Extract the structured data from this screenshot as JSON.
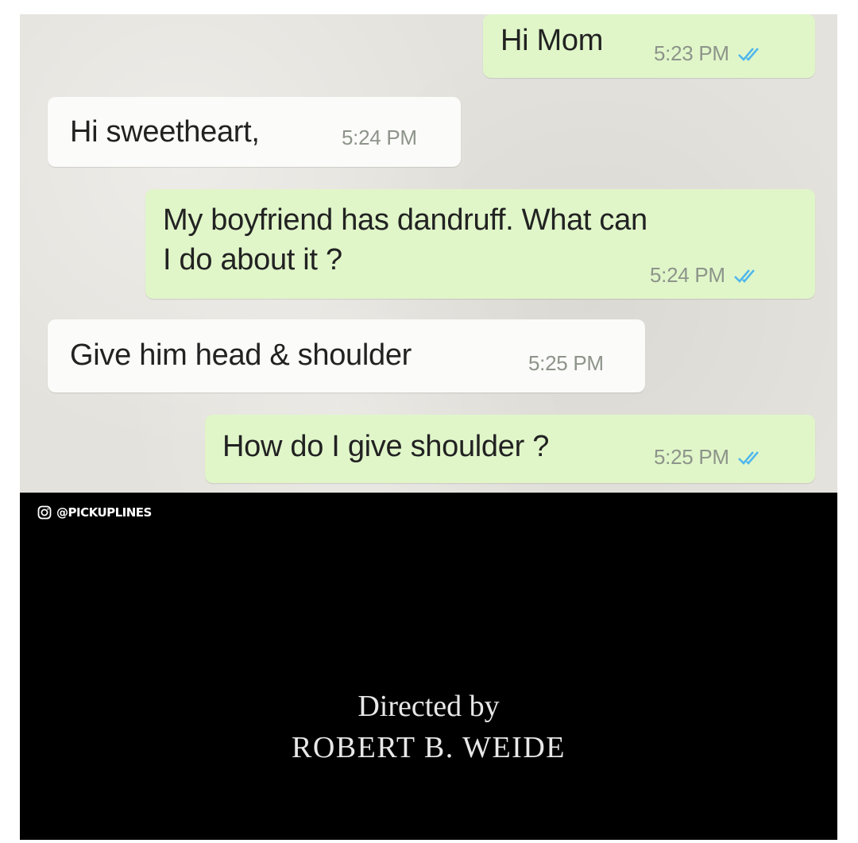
{
  "chat": {
    "messages": [
      {
        "direction": "outgoing",
        "text": "Hi Mom",
        "time": "5:23 PM",
        "status_icon": "double-check-icon"
      },
      {
        "direction": "incoming",
        "text": "Hi sweetheart,",
        "time": "5:24 PM"
      },
      {
        "direction": "outgoing",
        "lines": [
          "My boyfriend has dandruff. What can",
          "I do about it ?"
        ],
        "time": "5:24 PM",
        "status_icon": "double-check-icon"
      },
      {
        "direction": "incoming",
        "text": "Give him head & shoulder",
        "time": "5:25 PM"
      },
      {
        "direction": "outgoing",
        "text": "How do I give shoulder ?",
        "time": "5:25 PM",
        "status_icon": "double-check-icon"
      }
    ],
    "colors": {
      "outgoing_bubble": "#e0f6c9",
      "incoming_bubble": "#fbfbf9",
      "background": "#e4e2dc",
      "tick": "#4fb6ec"
    }
  },
  "watermark": {
    "icon": "instagram-icon",
    "handle": "@PICKUPLINES"
  },
  "credits": {
    "line1": "Directed by",
    "line2": "ROBERT B. WEIDE"
  }
}
